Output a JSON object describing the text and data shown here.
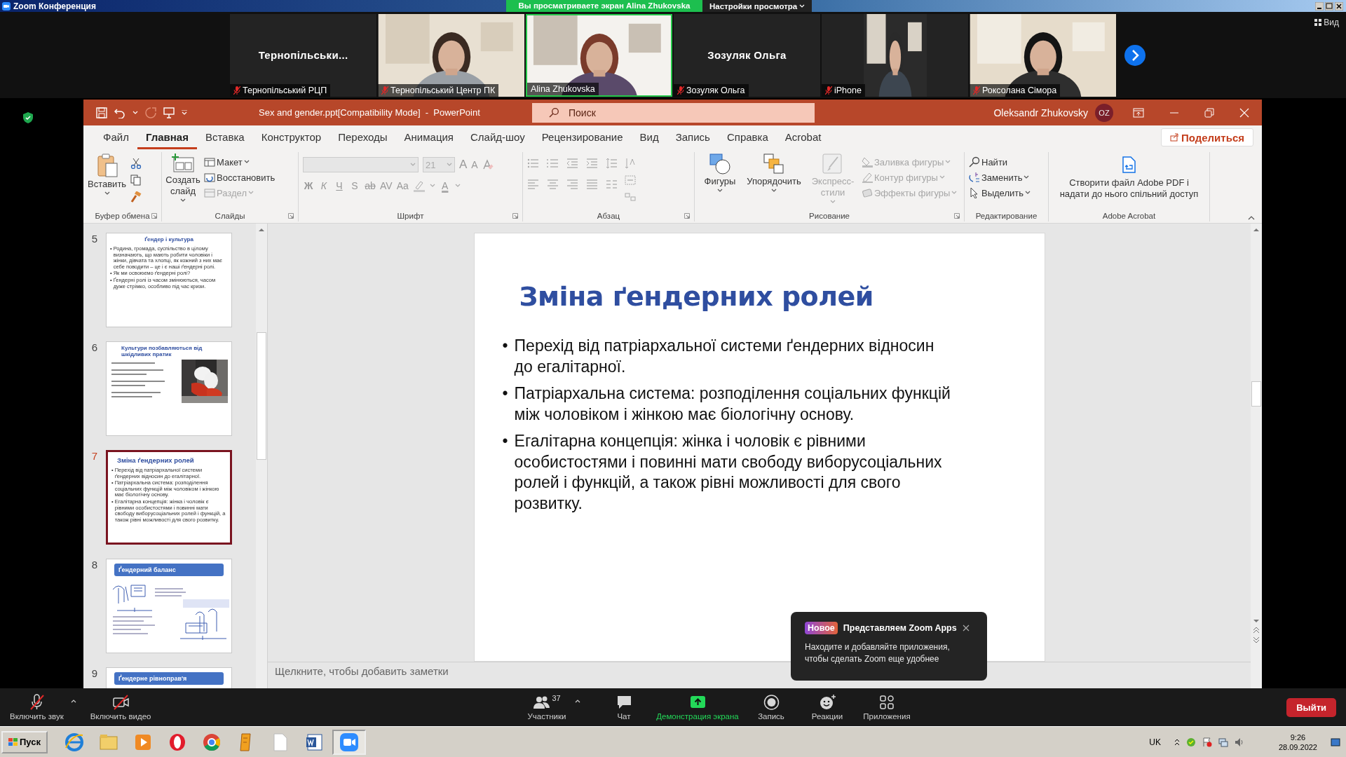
{
  "zoom_window": {
    "title": "Zoom Конференция"
  },
  "share_banner": {
    "text": "Вы просматриваете экран Alina Zhukovska",
    "view_options": "Настройки просмотра"
  },
  "view_button": "Вид",
  "participants": [
    {
      "kind": "name",
      "display_name": "Тернопільськи...",
      "label": "Тернопільський РЦП",
      "muted": true,
      "speaking": false
    },
    {
      "kind": "picture",
      "label": "Тернопільський Центр ПК",
      "muted": true,
      "speaking": false
    },
    {
      "kind": "picture",
      "label": "Alina Zhukovska",
      "muted": false,
      "speaking": true
    },
    {
      "kind": "name",
      "display_name": "Зозуляк Ольга",
      "label": "Зозуляк Ольга",
      "muted": true,
      "speaking": false
    },
    {
      "kind": "picture",
      "label": "iPhone",
      "muted": true,
      "speaking": false
    },
    {
      "kind": "picture",
      "label": "Роксолана Сімора",
      "muted": true,
      "speaking": false
    }
  ],
  "powerpoint": {
    "title": "Sex and gender.ppt[Compatibility Mode]  -  PowerPoint",
    "search": {
      "placeholder": "Поиск"
    },
    "user": "Oleksandr Zhukovsky",
    "avatar": "OZ",
    "tabs": [
      {
        "label": "Файл",
        "selected": false
      },
      {
        "label": "Главная",
        "selected": true
      },
      {
        "label": "Вставка",
        "selected": false
      },
      {
        "label": "Конструктор",
        "selected": false
      },
      {
        "label": "Переходы",
        "selected": false
      },
      {
        "label": "Анимация",
        "selected": false
      },
      {
        "label": "Слайд-шоу",
        "selected": false
      },
      {
        "label": "Рецензирование",
        "selected": false
      },
      {
        "label": "Вид",
        "selected": false
      },
      {
        "label": "Запись",
        "selected": false
      },
      {
        "label": "Справка",
        "selected": false
      },
      {
        "label": "Acrobat",
        "selected": false
      }
    ],
    "share_button": "Поделиться",
    "ribbon": [
      {
        "kind": "clipboard",
        "label": "Буфер обмена",
        "paste": "Вставить"
      },
      {
        "kind": "slides",
        "label": "Слайды",
        "new_slide": "Создать слайд",
        "items": [
          {
            "label": "Макет",
            "disabled": false
          },
          {
            "label": "Восстановить",
            "disabled": false
          },
          {
            "label": "Раздел",
            "disabled": true
          }
        ]
      },
      {
        "kind": "font",
        "label": "Шрифт",
        "size": "21",
        "grow": "A",
        "shrink": "A",
        "buttons": [
          "Ж",
          "К",
          "Ч",
          "S",
          "ab",
          "AV",
          "Aa"
        ],
        "color_button": "A"
      },
      {
        "kind": "paragraph",
        "label": "Абзац"
      },
      {
        "kind": "drawing",
        "label": "Рисование",
        "large": [
          {
            "label": "Фигуры",
            "disabled": false
          },
          {
            "label": "Упорядочить",
            "disabled": false
          },
          {
            "label": "Экспресс-стили",
            "disabled": true
          }
        ],
        "items": [
          {
            "label": "Заливка фигуры",
            "disabled": true
          },
          {
            "label": "Контур фигуры",
            "disabled": true
          },
          {
            "label": "Эффекты фигуры",
            "disabled": true
          }
        ]
      },
      {
        "kind": "editing",
        "label": "Редактирование",
        "items": [
          {
            "label": "Найти"
          },
          {
            "label": "Заменить"
          },
          {
            "label": "Выделить"
          }
        ]
      },
      {
        "kind": "acrobat",
        "label": "Adobe Acrobat",
        "button": "Створити файл Adobe PDF і надати до нього спільний доступ"
      }
    ],
    "thumbnails": [
      {
        "number": "5",
        "kind": "text",
        "selected": false,
        "title": "Ґендер і культура",
        "bullet": "•",
        "bullets": [
          "Родина, громада, суспільство в цілому визначають, що мають робити чоловіки і жінки, дівчата та хлопці, як кожний з них має себе поводити – це і є наші ґендерні ролі.",
          "Як ми освоюємо ґендерні ролі?",
          "Ґендерні ролі із часом змінюються, часом дуже стрімко, особливо під час кризи."
        ]
      },
      {
        "number": "6",
        "selected": false,
        "title": "Культури позбавляються від шкідливих пратик"
      },
      {
        "number": "7",
        "kind": "text",
        "selected": true,
        "title": "Зміна ґендерних ролей",
        "bullet": "•",
        "bullets": [
          "Перехід від патріархальної системи ґендерних відносин до егалітарної.",
          "Патріархальна система: розподілення соціальних функцій між чоловіком і жінкою має біологічну основу.",
          "Егалітарна концепція: жінка і чоловік є рівними особистостями і повинні мати свободу виборусоціальних ролей і функцій, а також рівні можливості для свого розвитку."
        ]
      },
      {
        "number": "8",
        "kind": "banner",
        "selected": false,
        "title": "Ґендерний баланс"
      },
      {
        "number": "9",
        "kind": "banner",
        "selected": false,
        "title": "Ґендерне рівноправ'я"
      }
    ],
    "slide": {
      "title": "Зміна ґендерних ролей",
      "bullet": "•",
      "bullets": [
        "Перехід від патріархальної системи ґендерних відносин до егалітарної.",
        "Патріархальна система: розподілення соціальних функцій між чоловіком і жінкою має біологічну основу.",
        "Егалітарна концепція: жінка і чоловік є рівними особистостями і повинні мати свободу виборусоціальних ролей і функцій, а також рівні можливості для свого розвитку."
      ]
    },
    "notes": {
      "placeholder": "Щелкните, чтобы добавить заметки"
    }
  },
  "popup": {
    "badge": "Новое",
    "title": "Представляем Zoom Apps",
    "text": "Находите и добавляйте приложения, чтобы сделать Zoom еще удобнее"
  },
  "toolbar": {
    "left": [
      {
        "kind": "mic",
        "label": "Включить звук"
      },
      {
        "kind": "video",
        "label": "Включить видео"
      }
    ],
    "center": [
      {
        "kind": "participants",
        "label": "Участники",
        "count": "37",
        "highlight": false
      },
      {
        "kind": "chat",
        "label": "Чат",
        "highlight": false
      },
      {
        "kind": "share",
        "label": "Демонстрация экрана",
        "highlight": true
      },
      {
        "kind": "record",
        "label": "Запись",
        "highlight": false
      },
      {
        "kind": "reactions",
        "label": "Реакции",
        "highlight": false
      },
      {
        "kind": "apps",
        "label": "Приложения",
        "highlight": false
      }
    ],
    "leave": "Выйти"
  },
  "taskbar": {
    "start": "Пуск",
    "apps": [
      {
        "selected": false
      },
      {
        "selected": false
      },
      {
        "selected": false
      },
      {
        "selected": false
      },
      {
        "selected": false
      },
      {
        "selected": false
      },
      {
        "selected": false
      },
      {
        "selected": false
      },
      {
        "selected": true
      }
    ],
    "language": "UK",
    "time": "9:26",
    "date": "28.09.2022"
  }
}
